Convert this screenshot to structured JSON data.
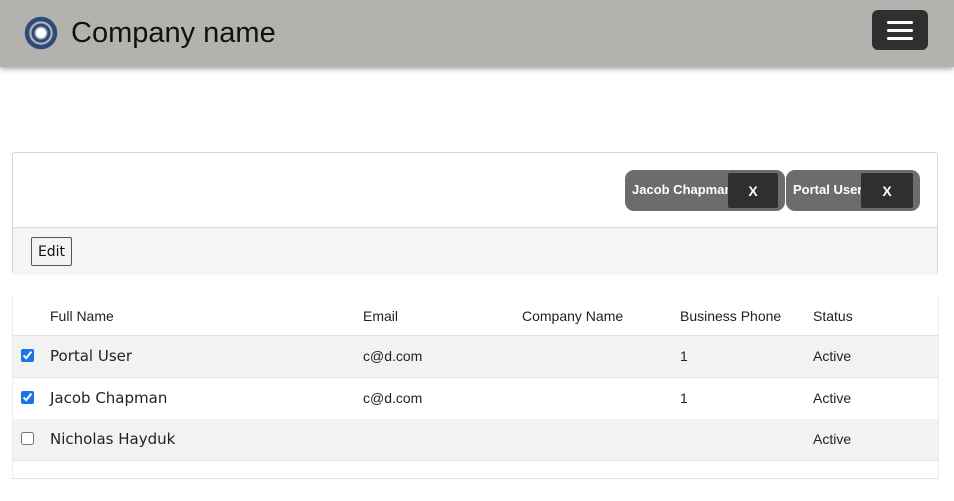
{
  "header": {
    "brand": "Company name",
    "logo_icon": "ring-logo-icon",
    "menu_icon": "hamburger-menu-icon",
    "colors": {
      "navbar": "#b3b2af",
      "menu_button": "#2f2f2f"
    }
  },
  "filters": {
    "chips": [
      {
        "label": "Jacob Chapman",
        "remove_label": "X"
      },
      {
        "label": "Portal User",
        "remove_label": "X"
      }
    ]
  },
  "toolbar": {
    "edit_label": "Edit"
  },
  "table": {
    "columns": [
      "Full Name",
      "Email",
      "Company Name",
      "Business Phone",
      "Status"
    ],
    "rows": [
      {
        "checked": true,
        "full_name": "Portal User",
        "email": "c@d.com",
        "company": "",
        "phone": "1",
        "status": "Active"
      },
      {
        "checked": true,
        "full_name": "Jacob Chapman",
        "email": "c@d.com",
        "company": "",
        "phone": "1",
        "status": "Active"
      },
      {
        "checked": false,
        "full_name": "Nicholas Hayduk",
        "email": "",
        "company": "",
        "phone": "",
        "status": "Active"
      }
    ]
  }
}
